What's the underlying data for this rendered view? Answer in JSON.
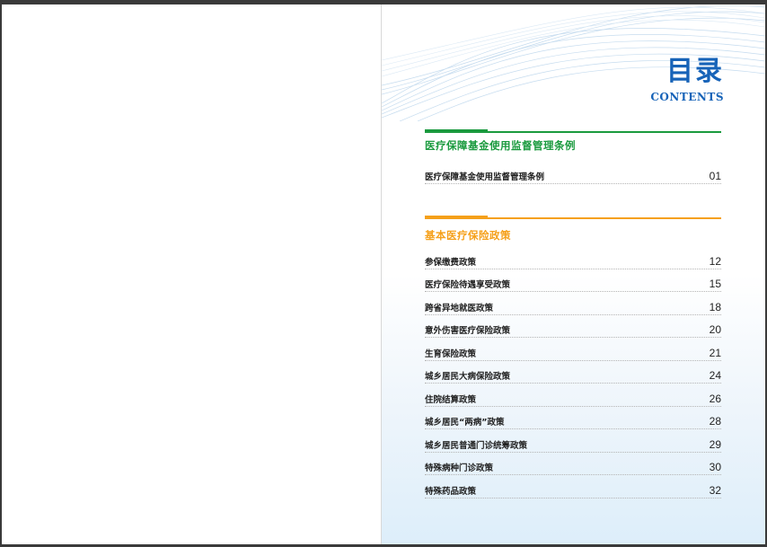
{
  "heading": {
    "title_cn": "目录",
    "title_en": "CONTENTS"
  },
  "colors": {
    "title": "#1763b8",
    "section1": "#1a9a3e",
    "section2": "#f5a01a"
  },
  "sections": [
    {
      "title": "医疗保障基金使用监督管理条例",
      "items": [
        {
          "label": "医疗保障基金使用监督管理条例",
          "page": "01"
        }
      ]
    },
    {
      "title": "基本医疗保险政策",
      "items": [
        {
          "label": "参保缴费政策",
          "page": "12"
        },
        {
          "label": "医疗保险待遇享受政策",
          "page": "15"
        },
        {
          "label": "跨省异地就医政策",
          "page": "18"
        },
        {
          "label": "意外伤害医疗保险政策",
          "page": "20"
        },
        {
          "label": "生育保险政策",
          "page": "21"
        },
        {
          "label": "城乡居民大病保险政策",
          "page": "24"
        },
        {
          "label": "住院结算政策",
          "page": "26"
        },
        {
          "label": "城乡居民“两病”政策",
          "page": "28"
        },
        {
          "label": "城乡居民普通门诊统筹政策",
          "page": "29"
        },
        {
          "label": "特殊病种门诊政策",
          "page": "30"
        },
        {
          "label": "特殊药品政策",
          "page": "32"
        }
      ]
    }
  ]
}
